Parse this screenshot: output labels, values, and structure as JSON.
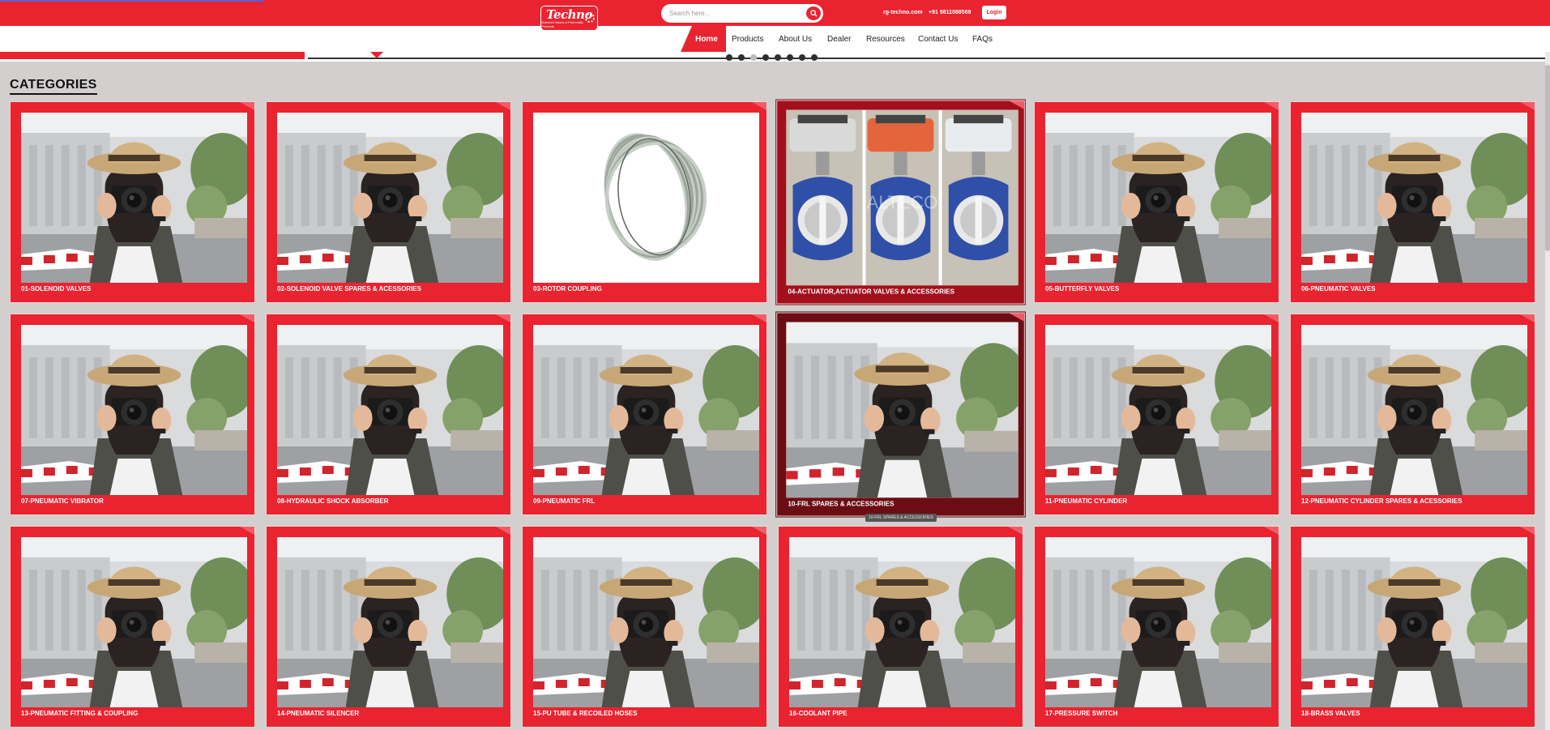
{
  "header": {
    "logo": {
      "name": "Techno",
      "tagline": "Solenoid Valves & Pneumatic Products"
    },
    "search": {
      "placeholder": "Search here..."
    },
    "contact": {
      "website": "rg-techno.com",
      "phone": "+91 9811088569"
    },
    "login_label": "Login"
  },
  "nav": {
    "items": [
      "Home",
      "Products",
      "About Us",
      "Dealer",
      "Resources",
      "Contact Us",
      "FAQs"
    ],
    "active": "Home"
  },
  "carousel": {
    "slide_count": 8,
    "active_index": 2
  },
  "categories": {
    "title": "CATEGORIES",
    "items": [
      {
        "label": "01-SOLENOID VALVES",
        "image": "photographer"
      },
      {
        "label": "02-SOLENOID VALVE SPARES & ACESSORIES",
        "image": "photographer"
      },
      {
        "label": "03-ROTOR COUPLING",
        "image": "coupling"
      },
      {
        "label": "04-ACTUATOR,ACTUATOR VALVES & ACCESSORIES",
        "image": "actuator"
      },
      {
        "label": "05-BUTTERFLY VALVES",
        "image": "photographer"
      },
      {
        "label": "06-PNEUMATIC VALVES",
        "image": "photographer"
      },
      {
        "label": "07-PNEUMATIC VIBRATOR",
        "image": "photographer"
      },
      {
        "label": "08-HYDRAULIC SHOCK ABSORBER",
        "image": "photographer"
      },
      {
        "label": "09-PNEUMATIC FRL",
        "image": "photographer"
      },
      {
        "label": "10-FRL SPARES & ACCESSORIES",
        "image": "photographer"
      },
      {
        "label": "11-PNEUMATIC CYLINDER",
        "image": "photographer"
      },
      {
        "label": "12-PNEUMATIC CYLINDER SPARES & ACESSORIES",
        "image": "photographer"
      },
      {
        "label": "13-PNEUMATIC FITTING & COUPLING",
        "image": "photographer"
      },
      {
        "label": "14-PNEUMATIC SILENCER",
        "image": "photographer"
      },
      {
        "label": "15-PU TUBE & RECOILED HOSES",
        "image": "photographer"
      },
      {
        "label": "16-COOLANT PIPE",
        "image": "photographer"
      },
      {
        "label": "17-PRESSURE SWITCH",
        "image": "photographer"
      },
      {
        "label": "18-BRASS VALVES",
        "image": "photographer"
      }
    ]
  },
  "tooltip": {
    "text": "10-FRL SPARES & ACCESSORIES"
  },
  "watermark": "ALTECO",
  "colors": {
    "brand": "#ea2330",
    "page_bg": "#d2cfce",
    "hover_dark": "#6b0d13"
  }
}
